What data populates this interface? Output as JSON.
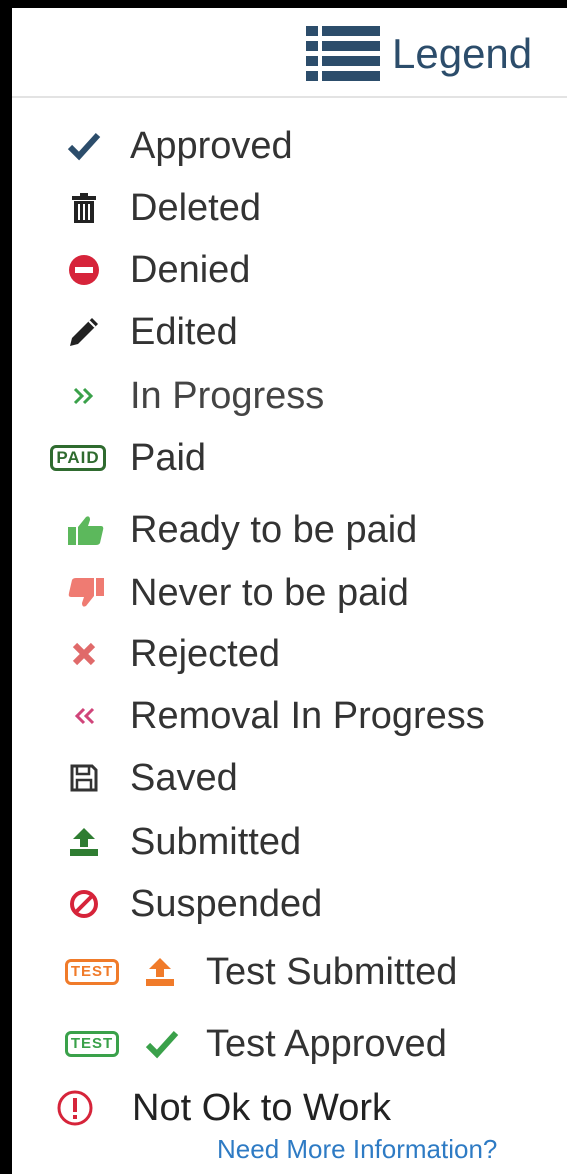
{
  "header": {
    "icon": "list-icon",
    "title": "Legend"
  },
  "items": [
    {
      "icon": "check-icon",
      "label": "Approved",
      "color": "#2c4d6b"
    },
    {
      "icon": "trash-icon",
      "label": "Deleted",
      "color": "#222222"
    },
    {
      "icon": "minus-circle-icon",
      "label": "Denied",
      "color": "#d6243a"
    },
    {
      "icon": "pencil-icon",
      "label": "Edited",
      "color": "#222222"
    },
    {
      "icon": "double-chevron-right-icon",
      "label": "In Progress",
      "color": "#3aa14a"
    },
    {
      "icon": "paid-badge-icon",
      "badge": "PAID",
      "label": "Paid",
      "color": "#2f6b2f"
    },
    {
      "icon": "thumbs-up-icon",
      "label": "Ready to be paid",
      "color": "#5cb85c"
    },
    {
      "icon": "thumbs-down-icon",
      "label": "Never to be paid",
      "color": "#ef7b72"
    },
    {
      "icon": "x-icon",
      "label": "Rejected",
      "color": "#e06a6a"
    },
    {
      "icon": "double-chevron-left-icon",
      "label": "Removal In Progress",
      "color": "#d0457a"
    },
    {
      "icon": "floppy-disk-icon",
      "label": "Saved",
      "color": "#333333"
    },
    {
      "icon": "upload-icon",
      "label": "Submitted",
      "color": "#2f7d32"
    },
    {
      "icon": "ban-icon",
      "label": "Suspended",
      "color": "#d6243a"
    },
    {
      "icon": "upload-icon",
      "badge": "TEST",
      "label": "Test Submitted",
      "color": "#f07b2a"
    },
    {
      "icon": "check-icon",
      "badge": "TEST",
      "label": "Test Approved",
      "color": "#3aa14a"
    },
    {
      "icon": "exclamation-circle-icon",
      "label": "Not Ok to Work",
      "color": "#d6243a"
    }
  ],
  "footer": {
    "link": "Need More Information?"
  }
}
